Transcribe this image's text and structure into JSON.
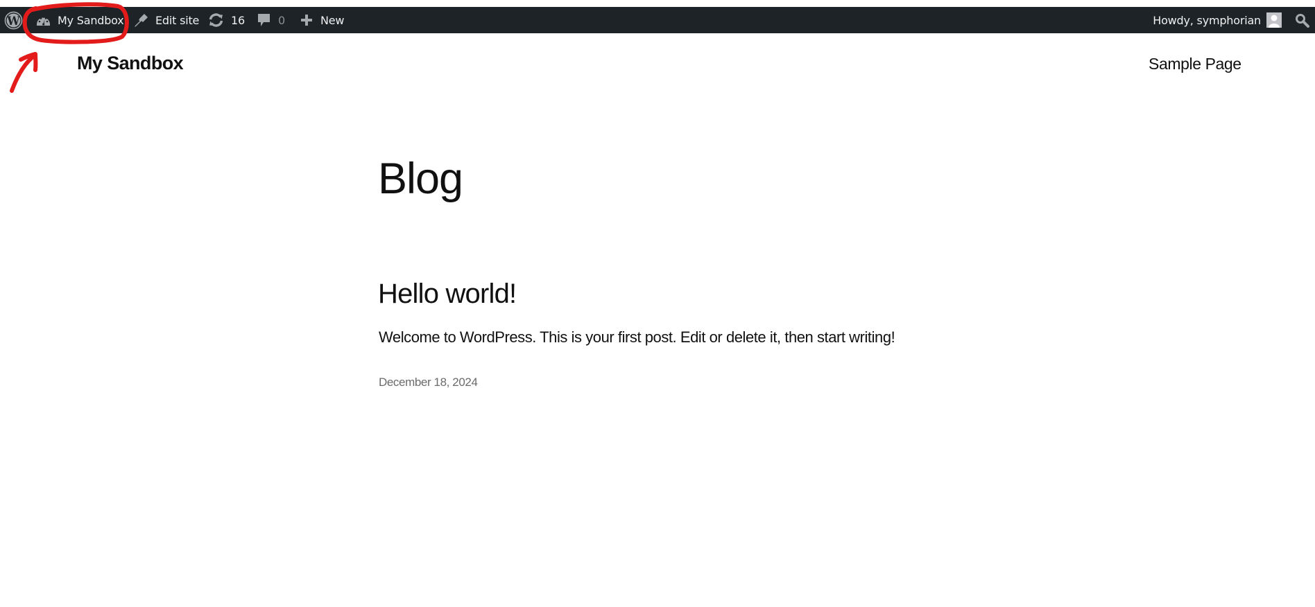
{
  "admin_bar": {
    "wp_logo_icon": "wordpress-logo-icon",
    "site": {
      "icon": "dashboard-gauge-icon",
      "label": "My Sandbox"
    },
    "edit_site": {
      "icon": "paintbrush-icon",
      "label": "Edit site"
    },
    "updates": {
      "icon": "refresh-icon",
      "count": "16"
    },
    "comments": {
      "icon": "comment-bubble-icon",
      "count": "0"
    },
    "new": {
      "icon": "plus-icon",
      "label": "New"
    },
    "account": {
      "greeting": "Howdy, symphorian",
      "avatar_icon": "avatar-icon"
    },
    "search_icon": "search-icon",
    "colors": {
      "background": "#1d2327",
      "text": "#f0f0f1",
      "icon": "#a7aaad"
    }
  },
  "site_header": {
    "title": "My Sandbox",
    "nav": [
      {
        "label": "Sample Page"
      }
    ]
  },
  "main": {
    "page_title": "Blog",
    "posts": [
      {
        "title": "Hello world!",
        "excerpt": "Welcome to WordPress. This is your first post. Edit or delete it, then start writing!",
        "date": "December 18, 2024"
      }
    ]
  },
  "annotation": {
    "type": "hand-drawn red circle and arrow highlighting the site name in the admin bar",
    "color": "#e31b1b"
  }
}
